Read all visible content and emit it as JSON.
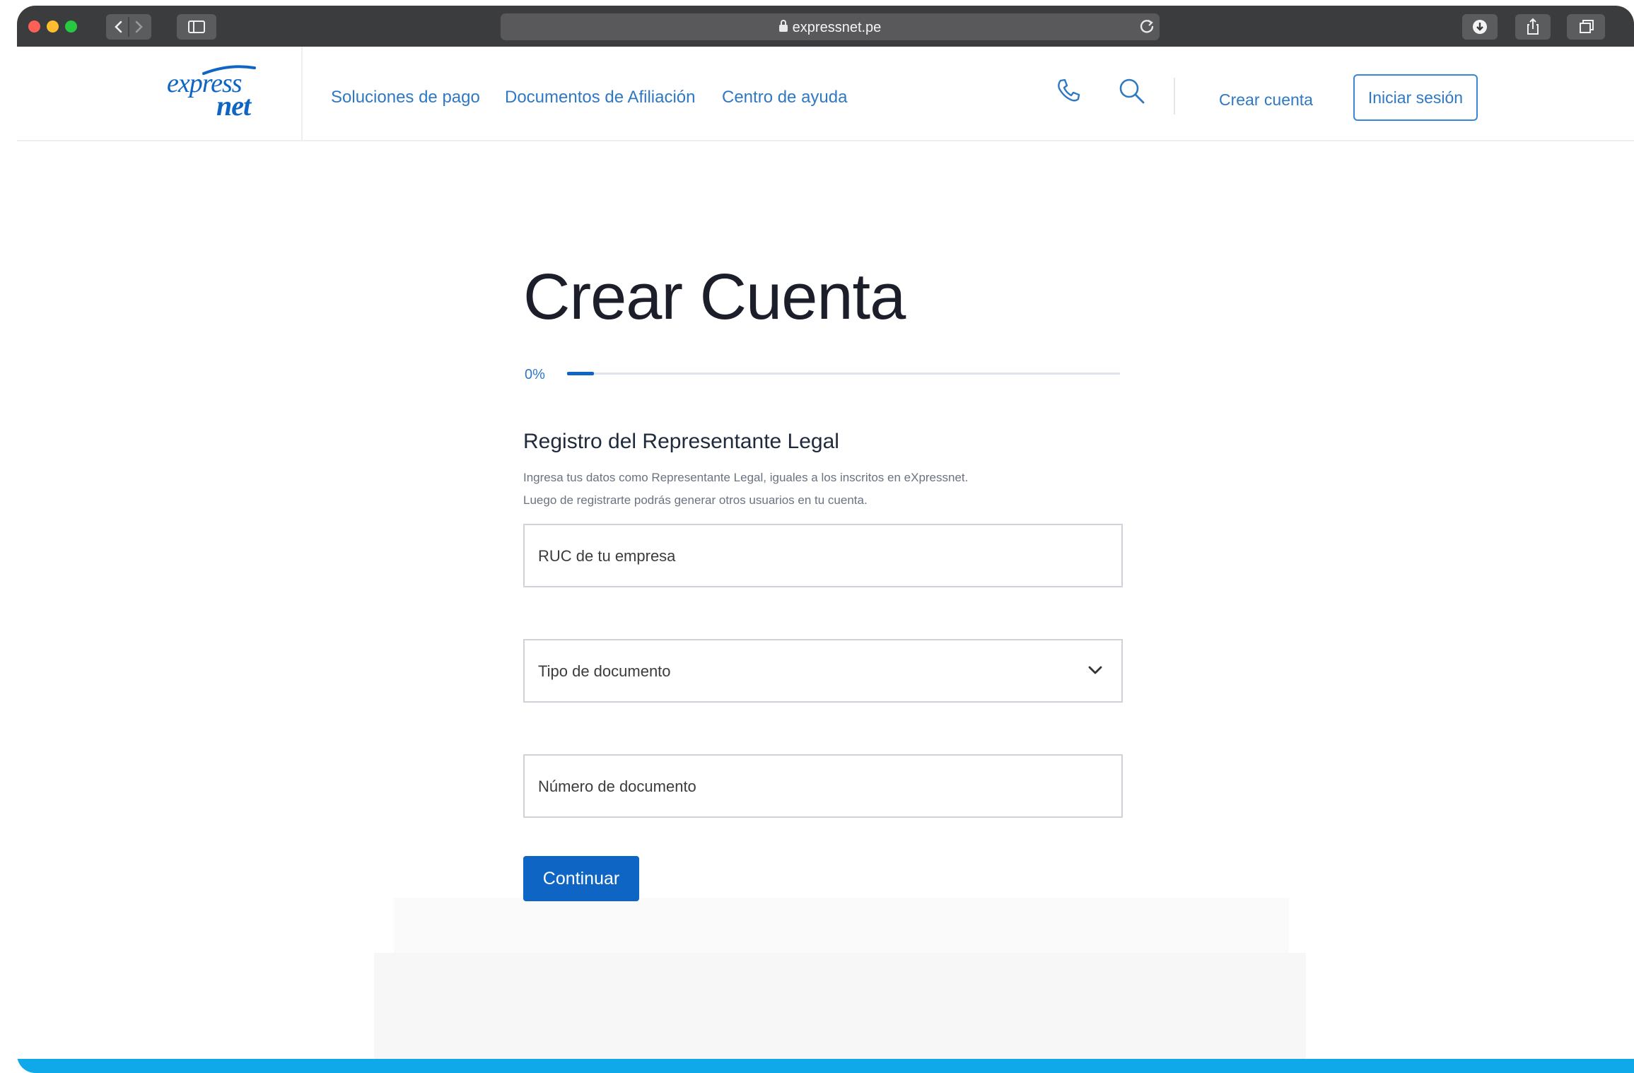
{
  "browser": {
    "url": "expressnet.pe",
    "toolbar_icons": [
      "back-icon",
      "forward-icon",
      "sidebar-icon",
      "reload-icon",
      "download-icon",
      "share-icon",
      "tabs-icon"
    ]
  },
  "header": {
    "logo": {
      "line1": "express",
      "line2": "net"
    },
    "nav": [
      "Soluciones de pago",
      "Documentos de Afiliación",
      "Centro de ayuda"
    ],
    "icons": [
      "phone-icon",
      "search-icon"
    ],
    "create_account": "Crear cuenta",
    "login": "Iniciar sesión"
  },
  "main": {
    "title": "Crear Cuenta",
    "progress": {
      "label": "0%",
      "value": 0
    },
    "section_title": "Registro del Representante Legal",
    "description_line1": "Ingresa tus datos como Representante Legal, iguales a los inscritos en eXpressnet.",
    "description_line2": "Luego de registrarte podrás generar otros usuarios en tu cuenta.",
    "fields": {
      "ruc_placeholder": "RUC de tu empresa",
      "doc_type_placeholder": "Tipo de documento",
      "doc_number_placeholder": "Número de documento"
    },
    "continue_label": "Continuar"
  },
  "colors": {
    "brand_blue": "#0f65c4",
    "link_blue": "#2f78c4",
    "toolbar": "#3b3c3e",
    "accent_bar": "#0fa8e8"
  }
}
